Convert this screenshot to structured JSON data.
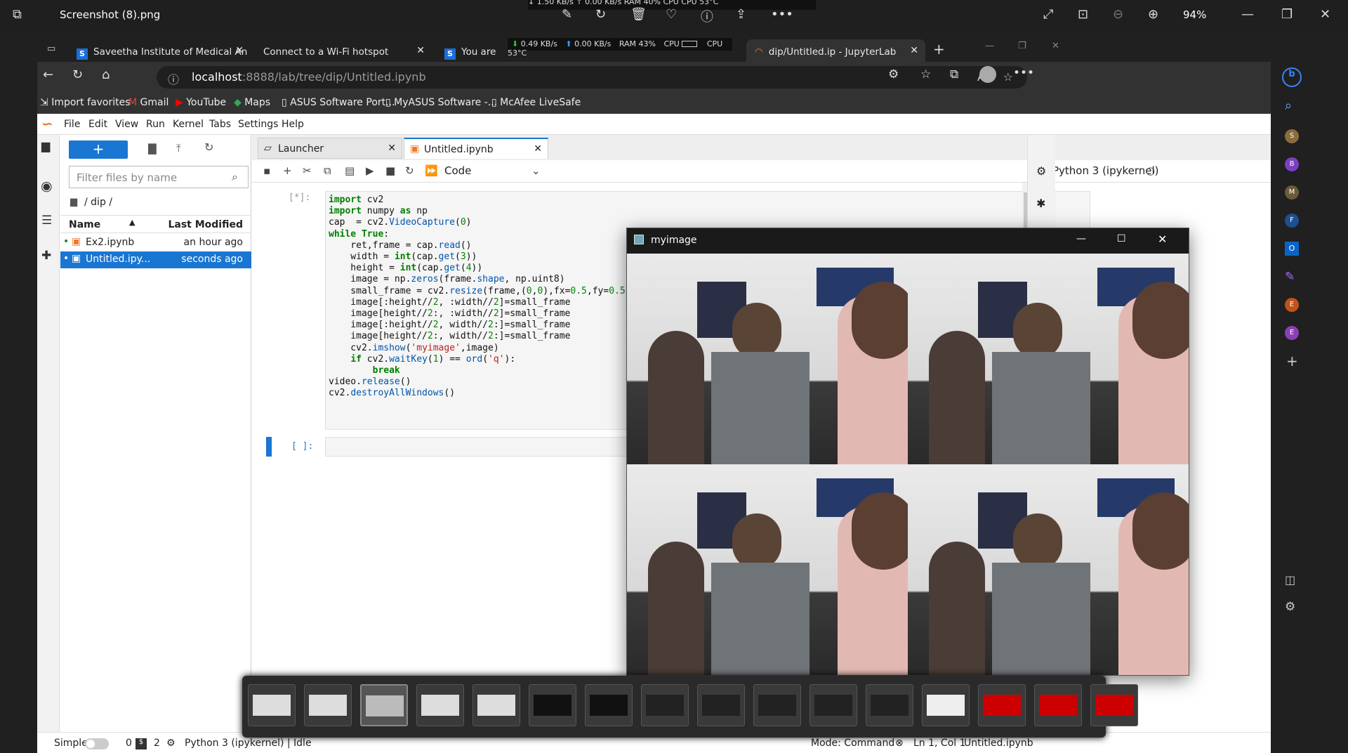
{
  "viewer": {
    "title": "Screenshot (8).png",
    "zoom": "94%",
    "sysmon_partial": "↓ 1.50 KB/s   ↑ 0.00 KB/s   RAM 40%   CPU     CPU 53°C"
  },
  "browser": {
    "tabs": [
      {
        "label": "Saveetha Institute of Medical An"
      },
      {
        "label": "Connect to a Wi-Fi hotspot"
      },
      {
        "label": "You are"
      },
      {
        "label": "dip/Untitled.ip - JupyterLab"
      }
    ],
    "sysmon": {
      "down": "0.49 KB/s",
      "up": "0.00 KB/s",
      "ram": "RAM 43%",
      "cpu": "CPU",
      "temp": "CPU 53°C"
    },
    "url_host": "localhost",
    "url_rest": ":8888/lab/tree/dip/Untitled.ipynb",
    "bookmarks": [
      "Import favorites",
      "Gmail",
      "YouTube",
      "Maps",
      "ASUS Software Port...",
      "MyASUS Software -...",
      "McAfee LiveSafe"
    ],
    "sidebar_profiles": [
      "S",
      "B",
      "M",
      "F",
      "E",
      "E"
    ],
    "colors": {
      "accent": "#1976d2",
      "youtube": "#ff0000"
    }
  },
  "jupyter": {
    "menus": [
      "File",
      "Edit",
      "View",
      "Run",
      "Kernel",
      "Tabs",
      "Settings",
      "Help"
    ],
    "filter_placeholder": "Filter files by name",
    "breadcrumb": "/ dip /",
    "columns": {
      "name": "Name",
      "modified": "Last Modified"
    },
    "files": [
      {
        "name": "Ex2.ipynb",
        "modified": "an hour ago"
      },
      {
        "name": "Untitled.ipy...",
        "modified": "seconds ago"
      }
    ],
    "tabs": [
      {
        "label": "Launcher"
      },
      {
        "label": "Untitled.ipynb"
      }
    ],
    "cell_type": "Code",
    "kernel": "Python 3 (ipykernel)",
    "cell1_prompt": "[*]:",
    "cell2_prompt": "[ ]:",
    "status": {
      "mode_label": "Simple",
      "count_a": "0",
      "count_b": "2",
      "kernel_status": "Python 3 (ipykernel) | Idle",
      "mode": "Mode: Command",
      "position": "Ln 1, Col 1",
      "file": "Untitled.ipynb"
    }
  },
  "cv_window": {
    "title": "myimage"
  }
}
